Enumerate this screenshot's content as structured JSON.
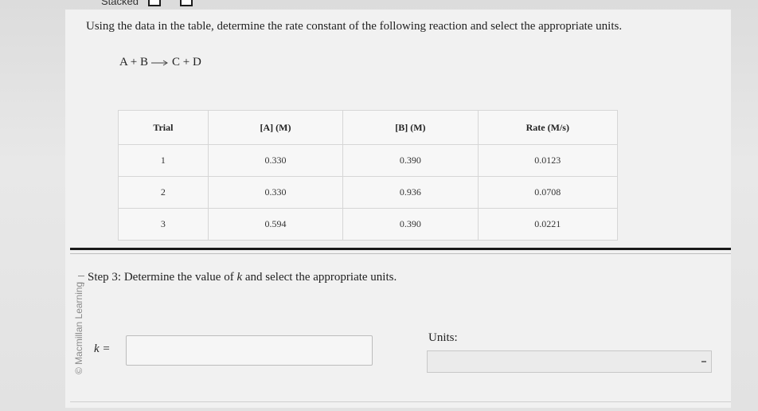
{
  "header": {
    "tab_label": "Stacked"
  },
  "question": {
    "prompt": "Using the data in the table, determine the rate constant of the following reaction and select the appropriate units.",
    "reaction": {
      "left": "A + B",
      "right": "C + D"
    }
  },
  "table": {
    "headers": [
      "Trial",
      "[A] (M)",
      "[B] (M)",
      "Rate (M/s)"
    ],
    "rows": [
      [
        "1",
        "0.330",
        "0.390",
        "0.0123"
      ],
      [
        "2",
        "0.330",
        "0.936",
        "0.0708"
      ],
      [
        "3",
        "0.594",
        "0.390",
        "0.0221"
      ]
    ]
  },
  "step": {
    "text_prefix": "Step 3: Determine the value of ",
    "variable": "k",
    "text_suffix": " and select the appropriate units."
  },
  "answer": {
    "k_label": "k =",
    "k_value": "",
    "units_label": "Units:",
    "units_value": ""
  },
  "credit": "© Macmillan Learning"
}
